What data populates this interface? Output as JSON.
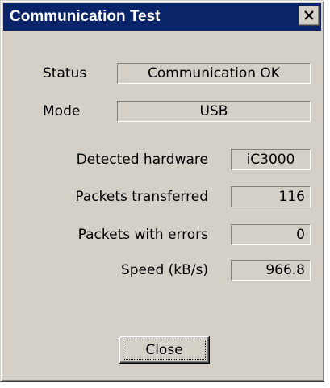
{
  "window": {
    "title": "Communication Test"
  },
  "status": {
    "label": "Status",
    "value": "Communication OK"
  },
  "mode": {
    "label": "Mode",
    "value": "USB"
  },
  "stats": [
    {
      "label": "Detected hardware",
      "value": "iC3000"
    },
    {
      "label": "Packets transferred",
      "value": "116"
    },
    {
      "label": "Packets with errors",
      "value": "0"
    },
    {
      "label": "Speed (kB/s)",
      "value": "966.8"
    }
  ],
  "buttons": {
    "close_label": "Close"
  },
  "icons": {
    "title_close": "close-icon"
  },
  "colors": {
    "titlebar": "#0a246a",
    "face": "#d4d0c8"
  }
}
